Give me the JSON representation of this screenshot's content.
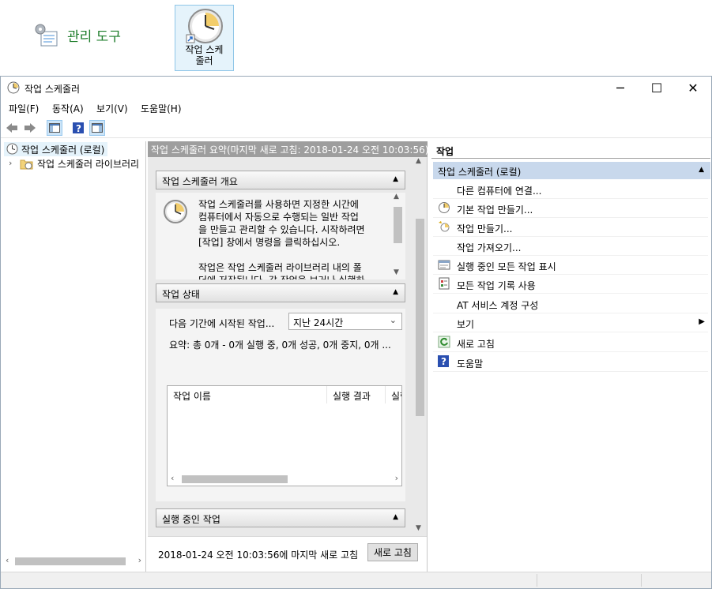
{
  "desktop": {
    "tools_label": "관리 도구",
    "tile_label": "작업 스케\n줄러"
  },
  "window": {
    "title": "작업 스케줄러",
    "controls": {
      "minimize": "─",
      "maximize": "☐",
      "close": "✕"
    },
    "menu": [
      "파일(F)",
      "동작(A)",
      "보기(V)",
      "도움말(H)"
    ]
  },
  "tree": {
    "root": "작업 스케줄러 (로컬)",
    "library": "작업 스케줄러 라이브러리"
  },
  "center": {
    "header": "작업 스케줄러 요약(마지막 새로 고침: 2018-01-24 오전 10:03:56)",
    "overview": {
      "title": "작업 스케줄러 개요",
      "text": "작업 스케줄러를 사용하면 지정한 시간에\n컴퓨터에서 자동으로 수행되는 일반 작업\n을 만들고 관리할 수 있습니다. 시작하려면\n[작업] 창에서 명령을 클릭하십시오.\n\n작업은 작업 스케줄러 라이브러리 내의 폴\n더에 저장됩니다. 각 작업을 보거나 실행하"
    },
    "status": {
      "title": "작업 상태",
      "period_label": "다음 기간에 시작된 작업...",
      "period_value": "지난 24시간",
      "summary": "요약: 총 0개 - 0개 실행 중, 0개 성공, 0개 중지, 0개 ...",
      "columns": [
        "작업 이름",
        "실행 결과",
        "실행"
      ]
    },
    "running": {
      "title": "실행 중인 작업"
    },
    "footer": {
      "last_refresh": "2018-01-24 오전 10:03:56에 마지막 새로 고침",
      "refresh_button": "새로 고침"
    }
  },
  "actions": {
    "title": "작업",
    "group": "작업 스케줄러 (로컬)",
    "items": [
      {
        "label": "다른 컴퓨터에 연결...",
        "icon": "none"
      },
      {
        "label": "기본 작업 만들기...",
        "icon": "clock-wizard-icon"
      },
      {
        "label": "작업 만들기...",
        "icon": "create-task-icon"
      },
      {
        "label": "작업 가져오기...",
        "icon": "none"
      },
      {
        "label": "실행 중인 모든 작업 표시",
        "icon": "running-tasks-icon"
      },
      {
        "label": "모든 작업 기록 사용",
        "icon": "history-icon"
      },
      {
        "label": "AT 서비스 계정 구성",
        "icon": "none"
      },
      {
        "label": "보기",
        "icon": "none"
      },
      {
        "label": "새로 고침",
        "icon": "refresh-icon"
      },
      {
        "label": "도움말",
        "icon": "help-icon"
      }
    ]
  },
  "colors": {
    "accent_green": "#1e7d2b",
    "selection": "#c8d8ec",
    "header_gray": "#9e9e9e"
  }
}
